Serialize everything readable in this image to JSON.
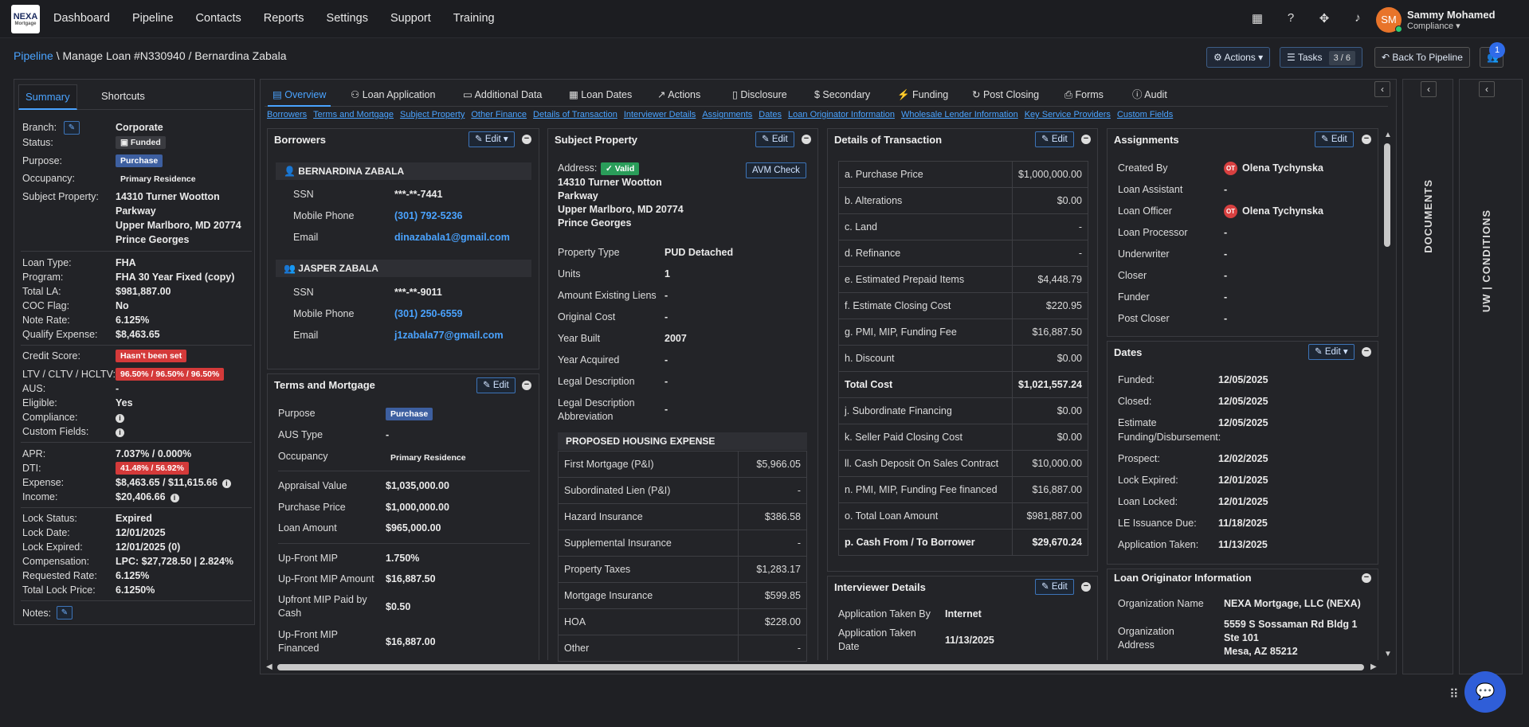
{
  "app": {
    "logo_main": "NEXA",
    "logo_sub": "Mortgage"
  },
  "nav": [
    "Dashboard",
    "Pipeline",
    "Contacts",
    "Reports",
    "Settings",
    "Support",
    "Training"
  ],
  "user": {
    "initials": "SM",
    "name": "Sammy Mohamed",
    "role": "Compliance ▾"
  },
  "breadcrumb": {
    "root": "Pipeline",
    "rest": " \\ Manage Loan #N330940 / Bernardina Zabala"
  },
  "header_buttons": {
    "actions": "Actions ▾",
    "tasks": "Tasks",
    "tasks_count": "3 / 6",
    "back": "Back To Pipeline",
    "bubble": "1"
  },
  "left": {
    "tabs": [
      "Summary",
      "Shortcuts"
    ],
    "branch": "Corporate",
    "status": "Funded",
    "purpose": "Purchase",
    "occupancy": "Primary Residence",
    "subject_property": [
      "14310 Turner Wootton",
      "Parkway",
      "Upper Marlboro, MD 20774",
      "Prince Georges"
    ],
    "loan_type": "FHA",
    "program": "FHA 30 Year Fixed (copy)",
    "total_la": "$981,887.00",
    "coc_flag": "No",
    "note_rate": "6.125%",
    "qualify_expense": "$8,463.65",
    "credit_score": "Hasn't been set",
    "ltv": "96.50% / 96.50% / 96.50%",
    "aus": "-",
    "eligible": "Yes",
    "apr": "7.037% / 0.000%",
    "dti": "41.48% / 56.92%",
    "expense": "$8,463.65 / $11,615.66",
    "income": "$20,406.66",
    "lock_status": "Expired",
    "lock_date": "12/01/2025",
    "lock_expired": "12/01/2025 (0)",
    "compensation": "LPC: $27,728.50 | 2.824%",
    "requested_rate": "6.125%",
    "total_lock_price": "6.1250%",
    "labels": {
      "branch": "Branch:",
      "status": "Status:",
      "purpose": "Purpose:",
      "occupancy": "Occupancy:",
      "subject_property": "Subject Property:",
      "loan_type": "Loan Type:",
      "program": "Program:",
      "total_la": "Total LA:",
      "coc_flag": "COC Flag:",
      "note_rate": "Note Rate:",
      "qualify_expense": "Qualify Expense:",
      "credit_score": "Credit Score:",
      "ltv": "LTV / CLTV / HCLTV:",
      "aus": "AUS:",
      "eligible": "Eligible:",
      "compliance": "Compliance:",
      "custom_fields": "Custom Fields:",
      "apr": "APR:",
      "dti": "DTI:",
      "expense": "Expense:",
      "income": "Income:",
      "lock_status": "Lock Status:",
      "lock_date": "Lock Date:",
      "lock_expired": "Lock Expired:",
      "compensation": "Compensation:",
      "requested_rate": "Requested Rate:",
      "total_lock_price": "Total Lock Price:",
      "notes": "Notes:"
    }
  },
  "tabs": [
    "Overview",
    "Loan Application",
    "Additional Data",
    "Loan Dates",
    "Actions",
    "Disclosure",
    "$ Secondary",
    "Funding",
    "Post Closing",
    "Forms",
    "Audit"
  ],
  "links": [
    "Borrowers",
    "Terms and Mortgage",
    "Subject Property",
    "Other Finance",
    "Details of Transaction",
    "Interviewer Details",
    "Assignments",
    "Dates",
    "Loan Originator Information",
    "Wholesale Lender Information",
    "Key Service Providers",
    "Custom Fields"
  ],
  "borrowers": {
    "title": "Borrowers",
    "edit": "Edit ▾",
    "list": [
      {
        "name": "BERNARDINA ZABALA",
        "ssn": "***-**-7441",
        "phone": "(301) 792-5236",
        "email": "dinazabala1@gmail.com"
      },
      {
        "name": "JASPER ZABALA",
        "ssn": "***-**-9011",
        "phone": "(301) 250-6559",
        "email": "j1zabala77@gmail.com"
      }
    ],
    "labels": {
      "ssn": "SSN",
      "phone": "Mobile Phone",
      "email": "Email"
    }
  },
  "terms": {
    "title": "Terms and Mortgage",
    "edit": "Edit",
    "purpose_l": "Purpose",
    "purpose": "Purchase",
    "aus_l": "AUS Type",
    "aus": "-",
    "occ_l": "Occupancy",
    "occ": "Primary Residence",
    "appraisal_l": "Appraisal Value",
    "appraisal": "$1,035,000.00",
    "pp_l": "Purchase Price",
    "pp": "$1,000,000.00",
    "la_l": "Loan Amount",
    "la": "$965,000.00",
    "ufmip_l": "Up-Front MIP",
    "ufmip": "1.750%",
    "ufmipa_l": "Up-Front MIP Amount",
    "ufmipa": "$16,887.50",
    "ufpaid_l1": "Upfront MIP Paid by",
    "ufpaid_l2": "Cash",
    "ufpaid": "$0.50",
    "uffin_l1": "Up-Front MIP",
    "uffin_l2": "Financed",
    "uffin": "$16,887.00"
  },
  "subject": {
    "title": "Subject Property",
    "edit": "Edit",
    "address_l": "Address:",
    "valid": "✓ Valid",
    "avm": "AVM Check",
    "address": [
      "14310 Turner Wootton",
      "Parkway",
      "Upper Marlboro, MD 20774",
      "Prince Georges"
    ],
    "rows": [
      [
        "Property Type",
        "PUD Detached"
      ],
      [
        "Units",
        "1"
      ],
      [
        "Amount Existing Liens",
        "-"
      ],
      [
        "Original Cost",
        "-"
      ],
      [
        "Year Built",
        "2007"
      ],
      [
        "Year Acquired",
        "-"
      ],
      [
        "Legal Description",
        "-"
      ]
    ],
    "legal_abbr_1": "Legal Description",
    "legal_abbr_2": "Abbreviation",
    "legal_abbr": "-",
    "phe_title": "PROPOSED HOUSING EXPENSE",
    "phe": [
      [
        "First Mortgage (P&I)",
        "$5,966.05"
      ],
      [
        "Subordinated Lien (P&I)",
        "-"
      ],
      [
        "Hazard Insurance",
        "$386.58"
      ],
      [
        "Supplemental Insurance",
        "-"
      ],
      [
        "Property Taxes",
        "$1,283.17"
      ],
      [
        "Mortgage Insurance",
        "$599.85"
      ],
      [
        "HOA",
        "$228.00"
      ],
      [
        "Other",
        "-"
      ]
    ]
  },
  "transaction": {
    "title": "Details of Transaction",
    "edit": "Edit",
    "rows": [
      [
        "a. Purchase Price",
        "$1,000,000.00"
      ],
      [
        "b. Alterations",
        "$0.00"
      ],
      [
        "c. Land",
        "-"
      ],
      [
        "d. Refinance",
        "-"
      ],
      [
        "e. Estimated Prepaid Items",
        "$4,448.79"
      ],
      [
        "f. Estimate Closing Cost",
        "$220.95"
      ],
      [
        "g. PMI, MIP, Funding Fee",
        "$16,887.50"
      ],
      [
        "h. Discount",
        "$0.00"
      ],
      [
        "Total Cost",
        "$1,021,557.24"
      ],
      [
        "j. Subordinate Financing",
        "$0.00"
      ],
      [
        "k. Seller Paid Closing Cost",
        "$0.00"
      ],
      [
        "ll. Cash Deposit On Sales Contract",
        "$10,000.00"
      ],
      [
        "n. PMI, MIP, Funding Fee financed",
        "$16,887.00"
      ],
      [
        "o. Total Loan Amount",
        "$981,887.00"
      ],
      [
        "p. Cash From / To Borrower",
        "$29,670.24"
      ]
    ]
  },
  "interviewer": {
    "title": "Interviewer Details",
    "edit": "Edit",
    "taken_by_l": "Application Taken By",
    "taken_by": "Internet",
    "date_l1": "Application Taken",
    "date_l2": "Date",
    "date": "11/13/2025"
  },
  "assignments": {
    "title": "Assignments",
    "edit": "Edit",
    "rows": [
      [
        "Created By",
        "Olena Tychynska"
      ],
      [
        "Loan Assistant",
        "-"
      ],
      [
        "Loan Officer",
        "Olena Tychynska"
      ],
      [
        "Loan Processor",
        "-"
      ],
      [
        "Underwriter",
        "-"
      ],
      [
        "Closer",
        "-"
      ],
      [
        "Funder",
        "-"
      ],
      [
        "Post Closer",
        "-"
      ]
    ],
    "ot": "OT"
  },
  "dates": {
    "title": "Dates",
    "edit": "Edit ▾",
    "funded_l": "Funded:",
    "funded": "12/05/2025",
    "closed_l": "Closed:",
    "closed": "12/05/2025",
    "est_l1": "Estimate",
    "est_l2": "Funding/Disbursement:",
    "est": "12/05/2025",
    "prospect_l": "Prospect:",
    "prospect": "12/02/2025",
    "lexp_l": "Lock Expired:",
    "lexp": "12/01/2025",
    "llock_l": "Loan Locked:",
    "llock": "12/01/2025",
    "le_l": "LE Issuance Due:",
    "le": "11/18/2025",
    "app_l": "Application Taken:",
    "app": "11/13/2025"
  },
  "loi": {
    "title": "Loan Originator Information",
    "org_l": "Organization Name",
    "org": "NEXA Mortgage, LLC (NEXA)",
    "addr_l1": "Organization",
    "addr_l2": "Address",
    "addr": [
      "5559 S Sossaman Rd Bldg 1",
      "Ste 101",
      "Mesa, AZ 85212"
    ]
  },
  "side": {
    "documents": "DOCUMENTS",
    "conditions": "UW | CONDITIONS"
  }
}
